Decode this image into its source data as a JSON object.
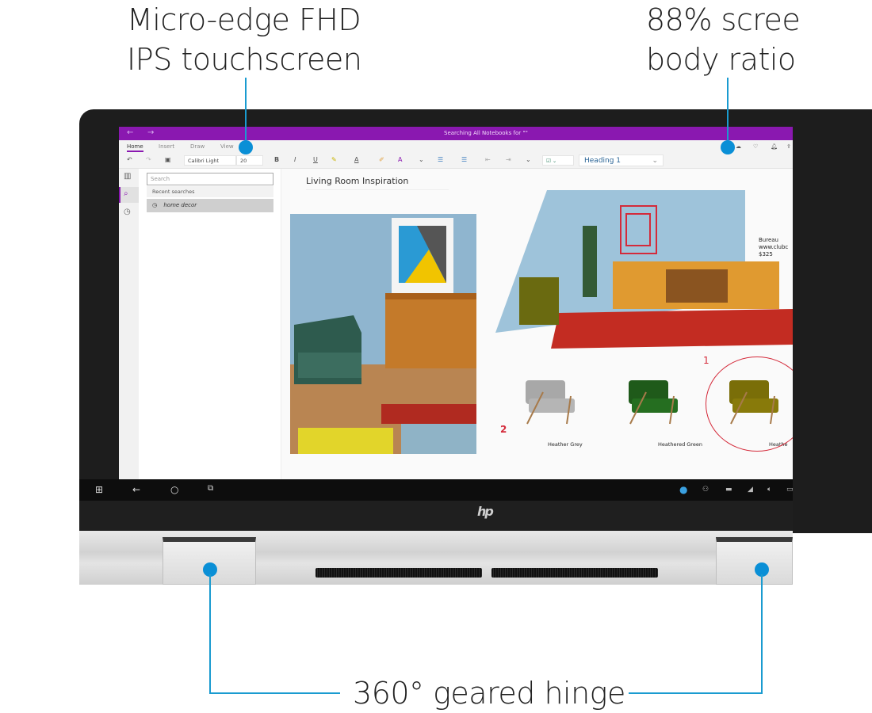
{
  "callouts": {
    "left": [
      "Micro-edge FHD",
      "IPS touchscreen"
    ],
    "right": [
      "88% scree",
      "body ratio"
    ],
    "bottom": "360° geared hinge"
  },
  "colors": {
    "accent_purple": "#8a18b0",
    "callout_blue": "#0a8fd6",
    "annotation_red": "#d42a3a"
  },
  "onenote": {
    "titlebar": {
      "back": "←",
      "forward": "→",
      "title": "Searching All Notebooks for \"\""
    },
    "tabs": [
      {
        "label": "Home",
        "active": true
      },
      {
        "label": "Insert",
        "active": false
      },
      {
        "label": "Draw",
        "active": false
      },
      {
        "label": "View",
        "active": false
      }
    ],
    "toolbar": {
      "font_name": "Calibri Light",
      "font_size": "20",
      "bold": "B",
      "italic": "I",
      "underline": "U",
      "style": "Heading 1",
      "icons": [
        "undo-icon",
        "redo-icon",
        "clipboard-icon",
        "highlighter-icon",
        "font-color-icon",
        "format-painter-icon",
        "clear-format-icon",
        "bullets-icon",
        "numbering-icon",
        "outdent-icon",
        "indent-icon",
        "todo-tag-icon"
      ],
      "right_icons": [
        "sync-icon",
        "lightbulb-icon",
        "bell-icon",
        "share-icon"
      ]
    },
    "search": {
      "placeholder": "Search",
      "recent_label": "Recent searches",
      "recent_items": [
        "home decor"
      ]
    },
    "page": {
      "title": "Living Room Inspiration",
      "bureau_caption": [
        "Bureau",
        "www.clubc",
        "$325"
      ],
      "swatches": [
        {
          "label": "Heather Grey",
          "color": "#a8a8a8",
          "mark": "2"
        },
        {
          "label": "Heathered Green",
          "color": "#1f5a1a",
          "mark": ""
        },
        {
          "label": "Heathe",
          "color": "#7a6e08",
          "mark": "1"
        }
      ]
    }
  },
  "taskbar": {
    "left_icons": [
      "windows-start-icon",
      "back-icon",
      "cortana-icon",
      "task-view-icon"
    ],
    "tray_icons": [
      "edge-icon",
      "people-icon",
      "battery-icon",
      "wifi-icon",
      "volume-mute-icon",
      "notification-icon"
    ]
  },
  "brand": {
    "logo": "hp"
  }
}
